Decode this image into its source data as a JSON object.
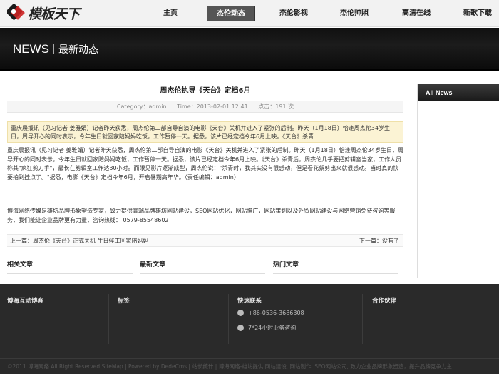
{
  "logo": {
    "text": "模板天下",
    "icon": "logo-mark-icon"
  },
  "nav": {
    "items": [
      {
        "label": "主页",
        "active": false
      },
      {
        "label": "杰伦动态",
        "active": true
      },
      {
        "label": "杰伦影视",
        "active": false
      },
      {
        "label": "杰伦帅照",
        "active": false
      },
      {
        "label": "高清在线",
        "active": false
      },
      {
        "label": "新歌下载",
        "active": false
      }
    ]
  },
  "banner": {
    "title": "NEWS",
    "subtitle": "最新动态"
  },
  "article": {
    "title": "周杰伦执导《天台》定档6月",
    "category": "Category：admin",
    "time": "Time：2013-02-01 12:41",
    "views": "点击：191 次",
    "summary": "重庆晨报讯（见习记者 姜雅娟）记者昨天获悉，周杰伦第二部自导自演的电影《天台》关机并进入了紧张的后制。昨天（1月18日）恰逢周杰伦34岁生日，周导开心的同时表示，今年生日就回家陪妈妈吃饭，工作暂停一天。据悉，该片已经定档今年6月上映。《天台》杀青",
    "body": "重庆晨报讯（见习记者 姜雅娟）记者昨天获悉，周杰伦第二部自导自演的电影《天台》关机并进入了紧张的后制。昨天（1月18日）恰逢周杰伦34岁生日，周导开心的同时表示，今年生日就回家陪妈妈吃饭，工作暂停一天。据悉，该片已经定档今年6月上映。《天台》杀青后，周杰伦几乎要把剪辑室当家，工作人员称其\"疯狂剪刀手\"，最长在剪辑室工作达30小时。而眼见影片逐渐成型，周杰伦说：\"杀青时，我其实没有很感动，但是看花絮剪出来就很感动。当时真的快要拍到挂点了。\"据悉，电影《天台》定档今年6月，开启暑期高年华。（责任编辑：admin）",
    "company": "博海网络传媒是雄坊品牌形象塑造专家，致力提供高端品牌雄坊网站建设，SEO网站优化，网站推广，网站策划以及外贸网站建设与网络营销免费咨询等服务，我们能让企业品牌更有力量，咨询热线： 0579-85548602",
    "prev": "上一篇：周杰伦《天台》正式关机 生日俘工回家陪妈妈",
    "next": "下一篇：没有了"
  },
  "blocks": [
    {
      "label": "相关文章"
    },
    {
      "label": "最新文章"
    },
    {
      "label": "热门文章"
    }
  ],
  "sidebar": {
    "title": "All News"
  },
  "footer": {
    "columns": [
      {
        "title": "博海互动博客"
      },
      {
        "title": "标签"
      },
      {
        "title": "快速联系"
      },
      {
        "title": "合作伙伴"
      }
    ],
    "phone": "+86-0536-3686308",
    "service": "7*24小时业务咨询",
    "copyright": "©2011 博海网络 All Right Reserved SiteMap | Powered by DedeCms | 站长统计 | 博海网络-雄坊提供 网站建设, 网站制作, SEO网站公司, 致力企业品牌形象塑造，提升品牌竞争力主"
  },
  "colors": {
    "accent": "#555555",
    "banner": "#111111",
    "footer": "#2a2a2a",
    "summary_bg": "#fbf3d4"
  }
}
